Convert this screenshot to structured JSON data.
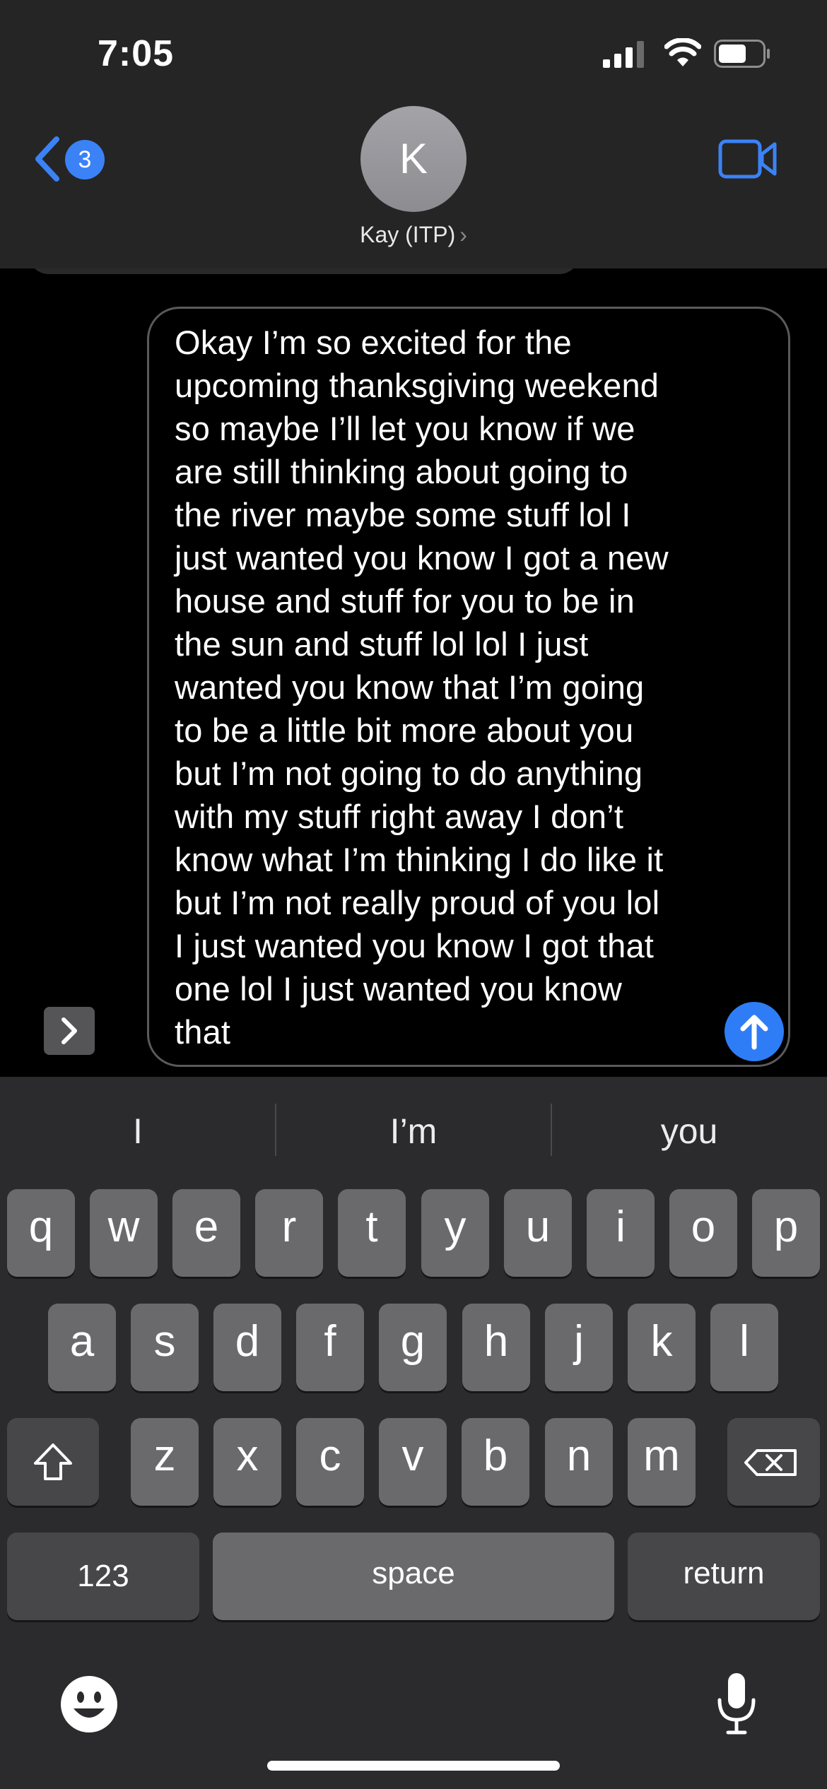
{
  "status_bar": {
    "time": "7:05"
  },
  "header": {
    "back_badge": "3",
    "avatar_initial": "K",
    "contact_name": "Kay (ITP)",
    "contact_chevron": "›",
    "icons": [
      "back-chevron-icon",
      "video-camera-icon",
      "signal-icon",
      "wifi-icon",
      "battery-icon"
    ]
  },
  "compose": {
    "lines": [
      "Okay I’m so excited for the",
      "upcoming thanksgiving weekend",
      "so maybe I’ll let you know if we",
      "are still thinking about going to",
      "the river maybe some stuff lol I",
      "just wanted you know I got a new",
      "house and stuff for you to be in",
      "the sun and stuff lol lol I just",
      "wanted you know that I’m going",
      "to be a little bit more about you",
      "but I’m not going to do anything",
      "with my stuff right away I don’t",
      "know what I’m thinking I do like it",
      "but I’m not really proud of you lol",
      "I just wanted you know I got that",
      "one lol I just wanted you know",
      "that"
    ]
  },
  "keyboard": {
    "suggestions": [
      "I",
      "I’m",
      "you"
    ],
    "row1": [
      "q",
      "w",
      "e",
      "r",
      "t",
      "y",
      "u",
      "i",
      "o",
      "p"
    ],
    "row2": [
      "a",
      "s",
      "d",
      "f",
      "g",
      "h",
      "j",
      "k",
      "l"
    ],
    "row3": [
      "z",
      "x",
      "c",
      "v",
      "b",
      "n",
      "m"
    ],
    "numbers_label": "123",
    "space_label": "space",
    "return_label": "return"
  },
  "colors": {
    "accent": "#2f7df6",
    "header_bg": "#252525",
    "keyboard_bg": "#2b2b2d"
  }
}
